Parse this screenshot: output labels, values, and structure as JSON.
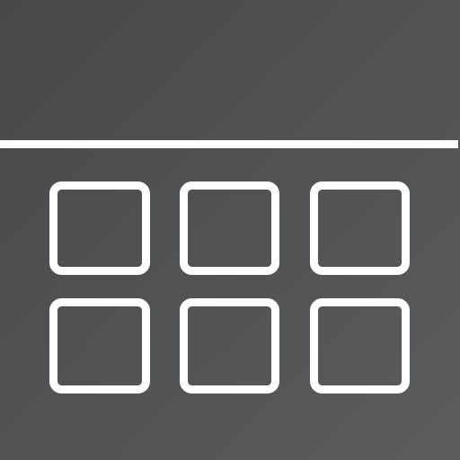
{
  "app_icon": {
    "icon": "calendar-grid-icon",
    "background_color": "#505153",
    "stroke_color": "#ffffff",
    "grid": {
      "rows": 2,
      "columns": 3,
      "cell_icon": "rounded-square-icon"
    }
  }
}
